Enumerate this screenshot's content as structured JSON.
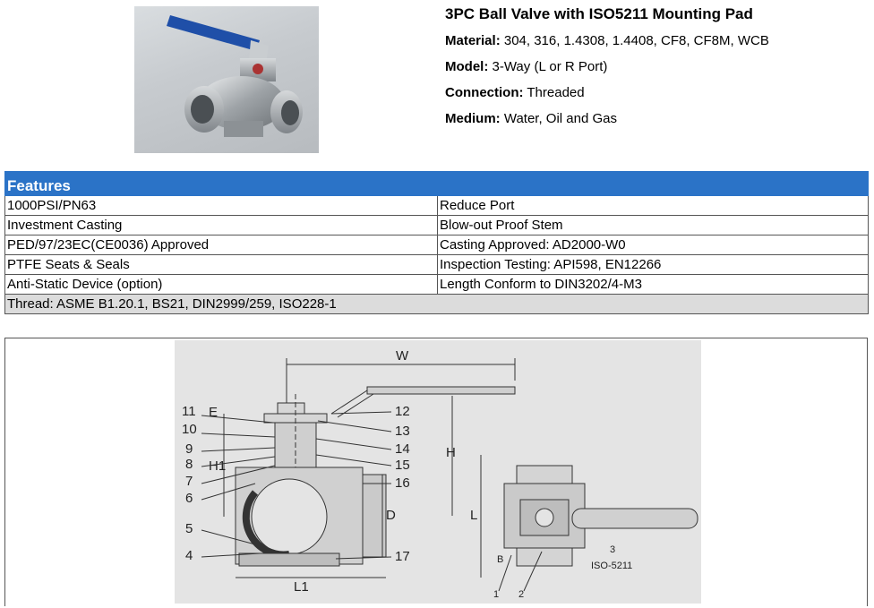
{
  "product": {
    "title": "3PC Ball Valve with ISO5211 Mounting Pad",
    "specs": [
      {
        "label": "Material:",
        "value": " 304, 316, 1.4308, 1.4408, CF8, CF8M, WCB"
      },
      {
        "label": "Model:",
        "value": " 3-Way (L or R Port)"
      },
      {
        "label": "Connection:",
        "value": " Threaded"
      },
      {
        "label": "Medium:",
        "value": " Water, Oil and Gas"
      }
    ]
  },
  "features": {
    "header": "Features",
    "rows": [
      [
        "1000PSI/PN63",
        "Reduce Port"
      ],
      [
        "Investment Casting",
        "Blow-out Proof Stem"
      ],
      [
        "PED/97/23EC(CE0036) Approved",
        "Casting Approved: AD2000-W0"
      ],
      [
        "PTFE Seats & Seals",
        "Inspection Testing: API598, EN12266"
      ],
      [
        "Anti-Static Device (option)",
        "Length Conform to DIN3202/4-M3"
      ]
    ],
    "last_row": "Thread: ASME B1.20.1, BS21, DIN2999/259, ISO228-1"
  },
  "drawing": {
    "dimension_labels": {
      "w": "W",
      "h": "H",
      "h1": "H1",
      "e": "E",
      "d": "D",
      "l": "L",
      "l1": "L1",
      "b": "B"
    },
    "part_numbers_left": [
      "11",
      "10",
      "9",
      "8",
      "7",
      "6",
      "5",
      "4"
    ],
    "part_numbers_right": [
      "12",
      "13",
      "14",
      "15",
      "16",
      "17"
    ],
    "side_view_numbers": [
      "1",
      "2",
      "3"
    ],
    "pad_label": "ISO-5211"
  },
  "colors": {
    "header_blue": "#2b73c7",
    "handle_blue": "#1f4fa8",
    "drawing_bg": "#e4e4e4"
  }
}
